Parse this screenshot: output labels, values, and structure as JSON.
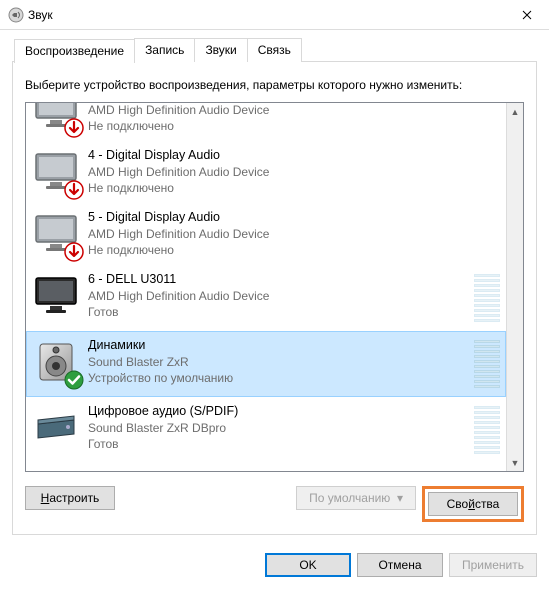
{
  "window": {
    "title": "Звук"
  },
  "tabs": [
    {
      "label": "Воспроизведение",
      "active": true
    },
    {
      "label": "Запись",
      "active": false
    },
    {
      "label": "Звуки",
      "active": false
    },
    {
      "label": "Связь",
      "active": false
    }
  ],
  "instruction": "Выберите устройство воспроизведения, параметры которого нужно изменить:",
  "devices": [
    {
      "name": "AMD High Definition Audio Device",
      "desc": "AMD High Definition Audio Device",
      "status": "Не подключено",
      "icon": "monitor-gray",
      "badge": "down",
      "meter": false,
      "cut": true
    },
    {
      "name": "4 - Digital Display Audio",
      "desc": "AMD High Definition Audio Device",
      "status": "Не подключено",
      "icon": "monitor-gray",
      "badge": "down",
      "meter": false
    },
    {
      "name": "5 - Digital Display Audio",
      "desc": "AMD High Definition Audio Device",
      "status": "Не подключено",
      "icon": "monitor-gray",
      "badge": "down",
      "meter": false
    },
    {
      "name": "6 - DELL U3011",
      "desc": "AMD High Definition Audio Device",
      "status": "Готов",
      "icon": "monitor-dark",
      "badge": "none",
      "meter": true
    },
    {
      "name": "Динамики",
      "desc": "Sound Blaster ZxR",
      "status": "Устройство по умолчанию",
      "icon": "speaker",
      "badge": "check",
      "meter": true,
      "selected": true
    },
    {
      "name": "Цифровое аудио (S/PDIF)",
      "desc": "Sound Blaster ZxR DBpro",
      "status": "Готов",
      "icon": "spdif",
      "badge": "none",
      "meter": true
    }
  ],
  "panel_buttons": {
    "configure": "Настроить",
    "default": "По умолчанию",
    "properties": "Свойства"
  },
  "dialog_buttons": {
    "ok": "OK",
    "cancel": "Отмена",
    "apply": "Применить"
  }
}
